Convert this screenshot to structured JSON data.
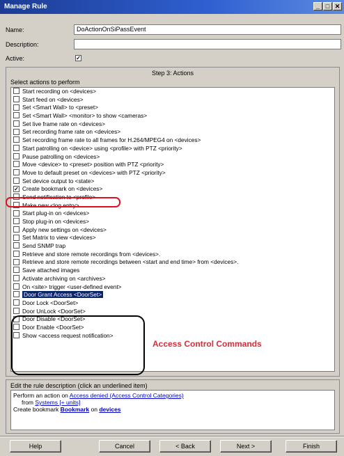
{
  "window": {
    "title": "Manage Rule",
    "min": "_",
    "max": "□",
    "close": "✕"
  },
  "form": {
    "name_label": "Name:",
    "name_value": "DoActionOnSiPassEvent",
    "description_label": "Description:",
    "description_value": "",
    "active_label": "Active:",
    "active_checked": "✓"
  },
  "step": {
    "title": "Step 3: Actions",
    "select_label": "Select actions to perform"
  },
  "actions": [
    {
      "label": "Start recording on <devices>",
      "check": ""
    },
    {
      "label": "Start feed on <devices>",
      "check": ""
    },
    {
      "label": "Set <Smart Wall> to <preset>",
      "check": ""
    },
    {
      "label": "Set <Smart Wall> <monitor> to show <cameras>",
      "check": ""
    },
    {
      "label": "Set live frame rate on <devices>",
      "check": ""
    },
    {
      "label": "Set recording frame rate on <devices>",
      "check": ""
    },
    {
      "label": "Set recording frame rate to all frames for H.264/MPEG4 on <devices>",
      "check": ""
    },
    {
      "label": "Start patrolling on <device> using <profile> with PTZ <priority>",
      "check": ""
    },
    {
      "label": "Pause patrolling on <devices>",
      "check": ""
    },
    {
      "label": "Move <device> to <preset> position with PTZ <priority>",
      "check": ""
    },
    {
      "label": "Move to default preset on <devices> with PTZ <priority>",
      "check": ""
    },
    {
      "label": "Set device output to <state>",
      "check": ""
    },
    {
      "label": "Create bookmark on <devices>",
      "check": "✓"
    },
    {
      "label": "Send notification to <profile>",
      "check": ""
    },
    {
      "label": "Make new <log entry>",
      "check": ""
    },
    {
      "label": "Start plug-in on <devices>",
      "check": ""
    },
    {
      "label": "Stop plug-in on <devices>",
      "check": ""
    },
    {
      "label": "Apply new settings on <devices>",
      "check": ""
    },
    {
      "label": "Set Matrix to view <devices>",
      "check": ""
    },
    {
      "label": "Send SNMP trap",
      "check": ""
    },
    {
      "label": "Retrieve and store remote recordings from <devices>.",
      "check": ""
    },
    {
      "label": "Retrieve and store remote recordings between <start and end time> from <devices>.",
      "check": ""
    },
    {
      "label": "Save attached images",
      "check": ""
    },
    {
      "label": "Activate archiving on <archives>",
      "check": ""
    },
    {
      "label": "On <site> trigger <user-defined event>",
      "check": ""
    },
    {
      "label": "Door Grant Access <DoorSet>",
      "check": ""
    },
    {
      "label": "Door Lock <DoorSet>",
      "check": ""
    },
    {
      "label": "Door UnLock <DoorSet>",
      "check": ""
    },
    {
      "label": "Door Disable <DoorSet>",
      "check": ""
    },
    {
      "label": "Door Enable <DoorSet>",
      "check": ""
    },
    {
      "label": "Show <access request notification>",
      "check": ""
    }
  ],
  "annotation": "Access Control Commands",
  "rule_desc": {
    "heading": "Edit the rule description (click an underlined item)",
    "l1_a": "Perform an action on ",
    "l1_link": "Access denied (Access Control Categories)",
    "l2_a": "from ",
    "l2_link": "Systems [+ units]",
    "l3_a": "Create bookmark ",
    "l3_link1": "Bookmark",
    "l3_mid": " on ",
    "l3_link2": "devices"
  },
  "buttons": {
    "help": "Help",
    "cancel": "Cancel",
    "back": "< Back",
    "next": "Next >",
    "finish": "Finish"
  },
  "colors": {
    "accent_red": "#e01020",
    "annotation_red": "#d42e3a",
    "selection": "#0a246a",
    "link": "#0000c8"
  }
}
